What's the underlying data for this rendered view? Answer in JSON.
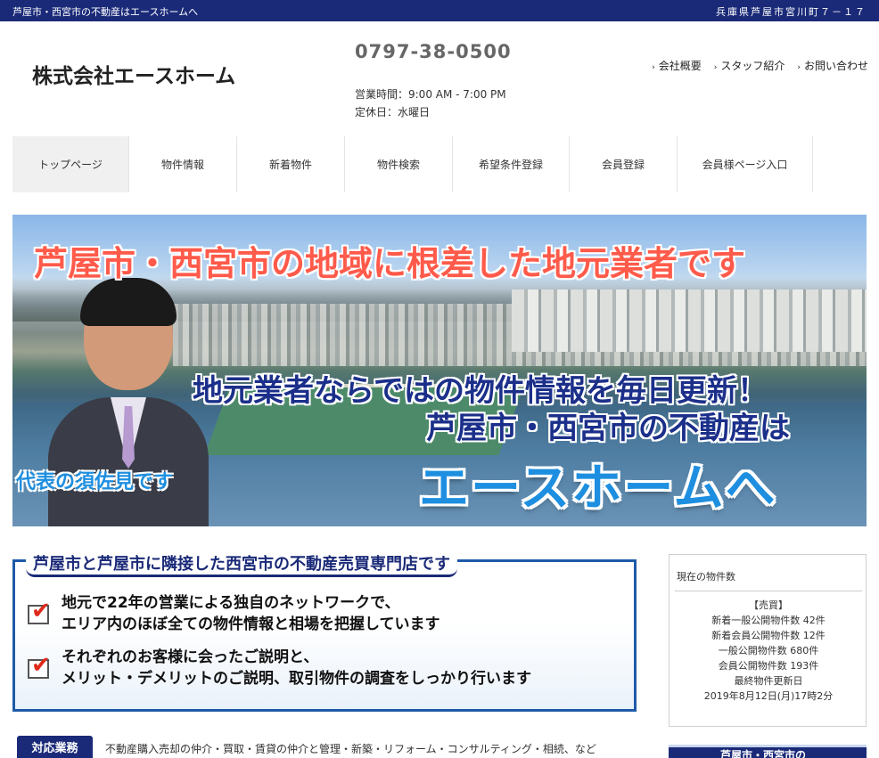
{
  "topbar": {
    "tagline": "芦屋市・西宮市の不動産はエースホームへ",
    "address": "兵庫県芦屋市宮川町７－１７"
  },
  "header": {
    "company": "株式会社エースホーム",
    "phone": "0797-38-0500",
    "hours": "営業時間：9:00 AM - 7:00 PM",
    "holiday": "定休日：水曜日",
    "links": [
      {
        "label": "会社概要"
      },
      {
        "label": "スタッフ紹介"
      },
      {
        "label": "お問い合わせ"
      }
    ]
  },
  "nav": [
    {
      "label": "トップページ"
    },
    {
      "label": "物件情報"
    },
    {
      "label": "新着物件"
    },
    {
      "label": "物件検索"
    },
    {
      "label": "希望条件登録"
    },
    {
      "label": "会員登録"
    },
    {
      "label": "会員様ページ入口"
    }
  ],
  "hero": {
    "headline": "芦屋市・西宮市の地域に根差した地元業者です",
    "line2": "地元業者ならではの物件情報を毎日更新！",
    "line3": "芦屋市・西宮市の不動産は",
    "line4": "エースホームへ",
    "caption": "代表の須佐見です"
  },
  "feature": {
    "title": "芦屋市と芦屋市に隣接した西宮市の不動産売買専門店です",
    "points": [
      {
        "line1": "地元で22年の営業による独自のネットワークで、",
        "line2": "エリア内のほぼ全ての物件情報と相場を把握しています"
      },
      {
        "line1": "それぞれのお客様に会ったご説明と、",
        "line2": "メリット・デメリットのご説明、取引物件の調査をしっかり行います"
      }
    ]
  },
  "sidebox": {
    "title": "現在の物件数",
    "category": "【売買】",
    "stats": [
      "新着一般公開物件数 42件",
      "新着会員公開物件数 12件",
      "一般公開物件数 680件",
      "会員公開物件数 193件"
    ],
    "updated_label": "最終物件更新日",
    "updated_value": "2019年8月12日(月)17時2分"
  },
  "services": {
    "label": "対応業務",
    "text": "不動産購入売却の仲介・買取・賃貸の仲介と管理・新築・リフォーム・コンサルティング・相続、など"
  },
  "banner_peek": {
    "text": "芦屋市・西宮市の"
  }
}
